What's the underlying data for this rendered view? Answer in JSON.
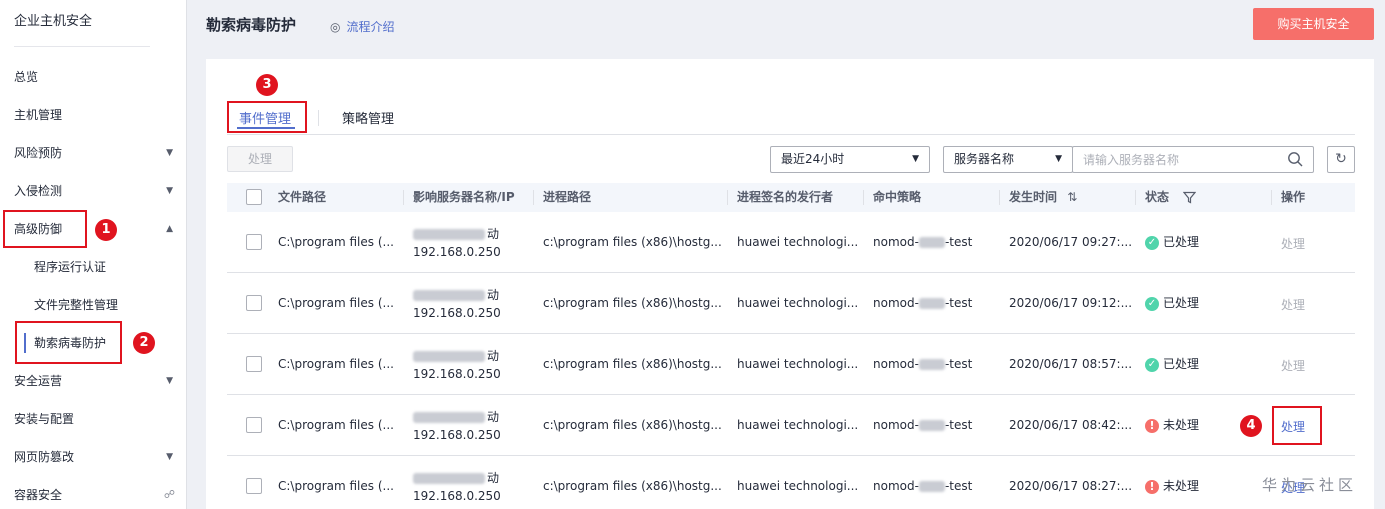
{
  "sidebar": {
    "title": "企业主机安全",
    "items": [
      {
        "label": "总览"
      },
      {
        "label": "主机管理"
      },
      {
        "label": "风险预防"
      },
      {
        "label": "入侵检测"
      },
      {
        "label": "高级防御"
      },
      {
        "label": "程序运行认证"
      },
      {
        "label": "文件完整性管理"
      },
      {
        "label": "勒索病毒防护"
      },
      {
        "label": "安全运营"
      },
      {
        "label": "安装与配置"
      },
      {
        "label": "网页防篡改"
      },
      {
        "label": "容器安全"
      }
    ]
  },
  "header": {
    "title": "勒索病毒防护",
    "flow_link": "流程介绍",
    "buy_button": "购买主机安全"
  },
  "tabs": [
    {
      "label": "事件管理"
    },
    {
      "label": "策略管理"
    }
  ],
  "toolbar": {
    "handle_button": "处理",
    "time_filter": "最近24小时",
    "search_field_type": "服务器名称",
    "search_placeholder": "请输入服务器名称"
  },
  "table": {
    "columns": [
      "文件路径",
      "影响服务器名称/IP",
      "进程路径",
      "进程签名的发行者",
      "命中策略",
      "发生时间",
      "状态",
      "操作"
    ],
    "rows": [
      {
        "file_path": "C:\\program files (...",
        "server_suffix": "动",
        "ip": "192.168.0.250",
        "process_path": "c:\\program files (x86)\\hostg...",
        "issuer": "huawei technologi...",
        "policy_prefix": "nomod-",
        "policy_suffix": "-test",
        "time": "2020/06/17 09:27:...",
        "status": "已处理",
        "action": "处理"
      },
      {
        "file_path": "C:\\program files (...",
        "server_suffix": "动",
        "ip": "192.168.0.250",
        "process_path": "c:\\program files (x86)\\hostg...",
        "issuer": "huawei technologi...",
        "policy_prefix": "nomod-",
        "policy_suffix": "-test",
        "time": "2020/06/17 09:12:...",
        "status": "已处理",
        "action": "处理"
      },
      {
        "file_path": "C:\\program files (...",
        "server_suffix": "动",
        "ip": "192.168.0.250",
        "process_path": "c:\\program files (x86)\\hostg...",
        "issuer": "huawei technologi...",
        "policy_prefix": "nomod-",
        "policy_suffix": "-test",
        "time": "2020/06/17 08:57:...",
        "status": "已处理",
        "action": "处理"
      },
      {
        "file_path": "C:\\program files (...",
        "server_suffix": "动",
        "ip": "192.168.0.250",
        "process_path": "c:\\program files (x86)\\hostg...",
        "issuer": "huawei technologi...",
        "policy_prefix": "nomod-",
        "policy_suffix": "-test",
        "time": "2020/06/17 08:42:...",
        "status": "未处理",
        "action": "处理"
      },
      {
        "file_path": "C:\\program files (...",
        "server_suffix": "动",
        "ip": "192.168.0.250",
        "process_path": "c:\\program files (x86)\\hostg...",
        "issuer": "huawei technologi...",
        "policy_prefix": "nomod-",
        "policy_suffix": "-test",
        "time": "2020/06/17 08:27:...",
        "status": "未处理",
        "action": "处理"
      }
    ]
  },
  "annotations": {
    "step1": "1",
    "step2": "2",
    "step3": "3",
    "step4": "4"
  },
  "watermark": "华为云社区",
  "colors": {
    "accent": "#526ecc",
    "buy_button": "#f66f6a",
    "status_ok": "#50d4ab",
    "status_warn": "#f66f6a",
    "annotation_red": "#e0141f"
  }
}
